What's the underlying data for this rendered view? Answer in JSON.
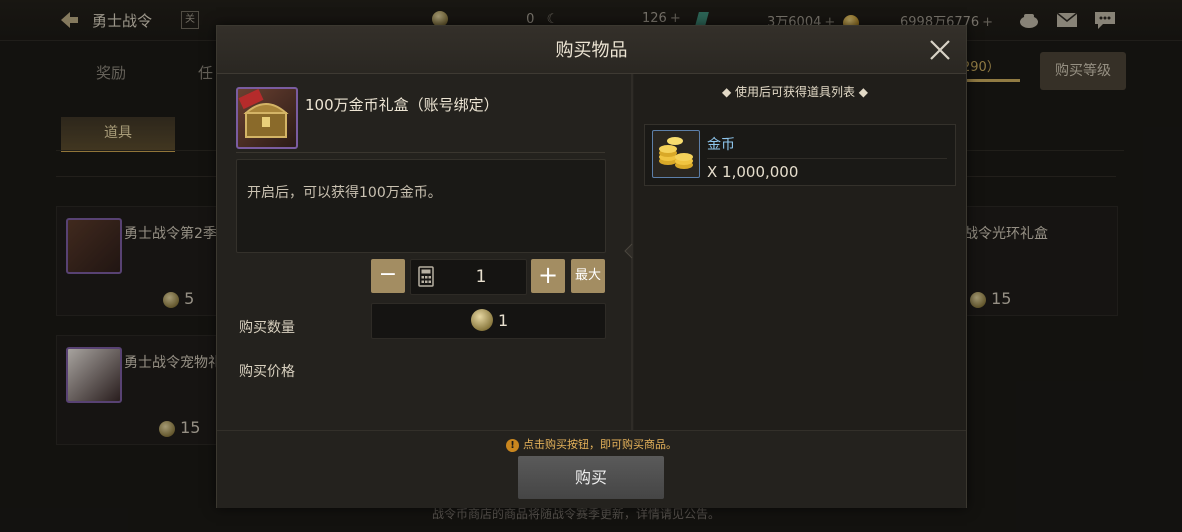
{
  "header": {
    "title": "勇士战令",
    "badge": "关",
    "currencies": [
      {
        "value": "0",
        "icon": "crescent-currency-icon"
      },
      {
        "value": "126",
        "icon": "gem-icon"
      },
      {
        "value": "3万6004",
        "icon": "gold-coin-icon"
      },
      {
        "value": "6998万6776",
        "icon": "gold-coin-icon"
      }
    ],
    "icons": [
      "cauldron-icon",
      "mail-icon",
      "chat-icon"
    ]
  },
  "background": {
    "tabs": [
      "奖励",
      "任"
    ],
    "progress_text": "290）",
    "level_button": "购买等级",
    "subtab": "道具",
    "cards": [
      {
        "name": "勇士战令第2季",
        "price": "5"
      },
      {
        "name": "战令光环礼盒",
        "price": "15"
      },
      {
        "name": "勇士战令宠物礼",
        "price": "15"
      }
    ],
    "footer_note": "战令币商店的商品将随战令赛季更新，详情请见公告。"
  },
  "dialog": {
    "title": "购买物品",
    "item": {
      "name": "100万金币礼盒（账号绑定）",
      "description": "开启后，可以获得100万金币。",
      "icon": "treasure-chest-icon"
    },
    "quantity_label": "购买数量",
    "quantity": "1",
    "minus": "−",
    "plus": "+",
    "max": "最大",
    "price_label": "购买价格",
    "price": "1",
    "list_title": "◆ 使用后可获得道具列表 ◆",
    "rewards": [
      {
        "name": "金币",
        "qty": "X 1,000,000",
        "icon": "gold-coins-icon"
      }
    ],
    "hint": "点击购买按钮，即可购买商品。",
    "buy": "购买"
  },
  "colors": {
    "accent_gold": "#c9a34f",
    "button_tan": "#a38d62",
    "reward_name": "#8fc7ee",
    "hint": "#e6b35a"
  }
}
